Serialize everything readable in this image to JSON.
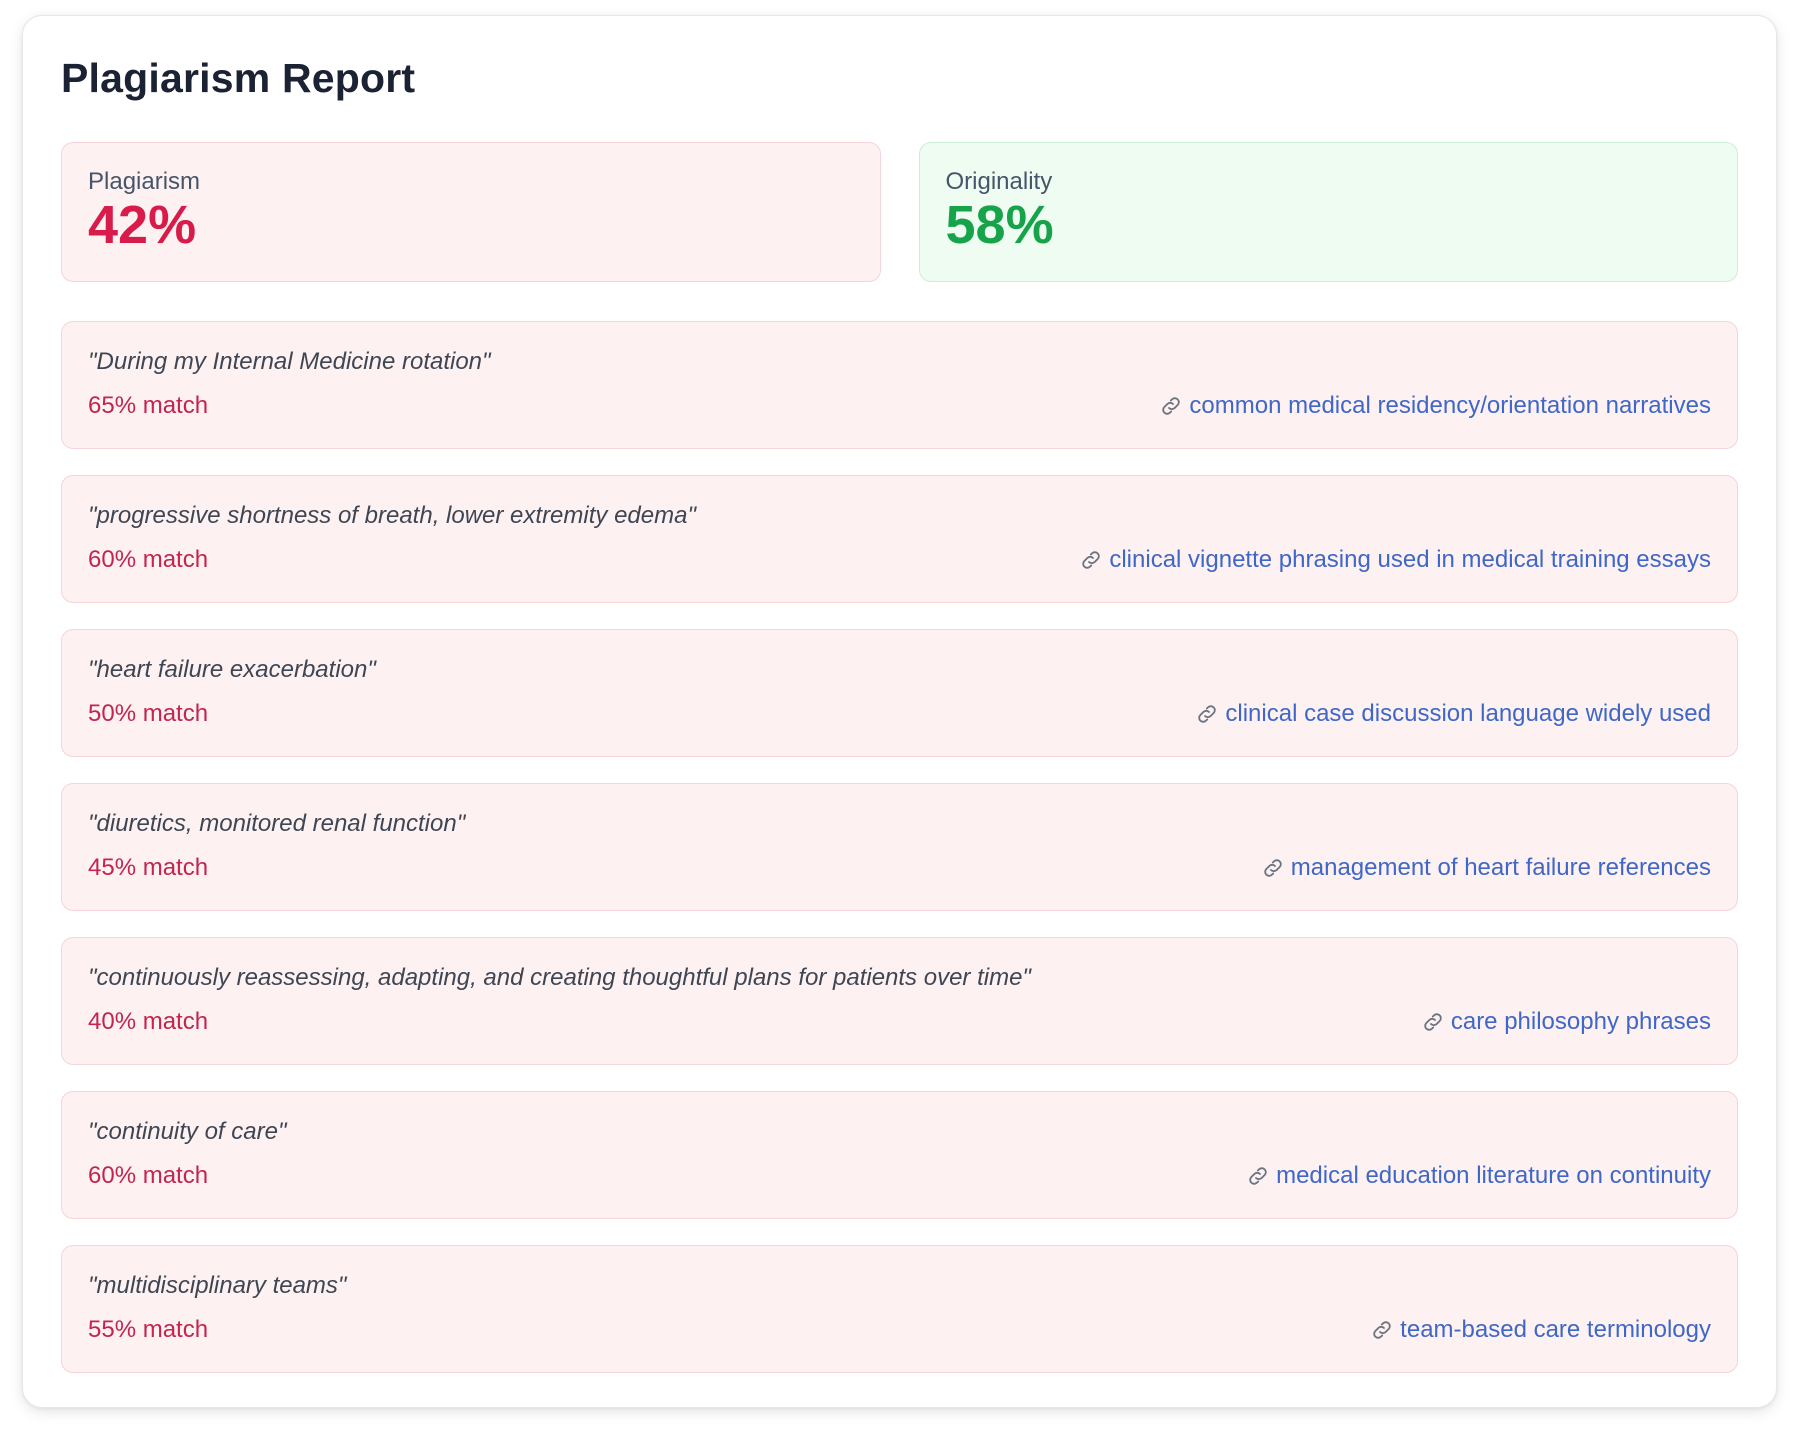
{
  "report": {
    "title": "Plagiarism Report"
  },
  "stats": {
    "plagiarism": {
      "label": "Plagiarism",
      "value": "42%",
      "color": "#d81b4a"
    },
    "originality": {
      "label": "Originality",
      "value": "58%",
      "color": "#16a34a"
    }
  },
  "matches": [
    {
      "quote": "\"During my Internal Medicine rotation\"",
      "match": "65% match",
      "source": "common medical residency/orientation narratives",
      "source_icon": "link-icon"
    },
    {
      "quote": "\"progressive shortness of breath, lower extremity edema\"",
      "match": "60% match",
      "source": "clinical vignette phrasing used in medical training essays",
      "source_icon": "link-icon"
    },
    {
      "quote": "\"heart failure exacerbation\"",
      "match": "50% match",
      "source": "clinical case discussion language widely used",
      "source_icon": "link-icon"
    },
    {
      "quote": "\"diuretics, monitored renal function\"",
      "match": "45% match",
      "source": "management of heart failure references",
      "source_icon": "link-icon"
    },
    {
      "quote": "\"continuously reassessing, adapting, and creating thoughtful plans for patients over time\"",
      "match": "40% match",
      "source": "care philosophy phrases",
      "source_icon": "link-icon"
    },
    {
      "quote": "\"continuity of care\"",
      "match": "60% match",
      "source": "medical education literature on continuity",
      "source_icon": "link-icon"
    },
    {
      "quote": "\"multidisciplinary teams\"",
      "match": "55% match",
      "source": "team-based care terminology",
      "source_icon": "link-icon"
    }
  ]
}
